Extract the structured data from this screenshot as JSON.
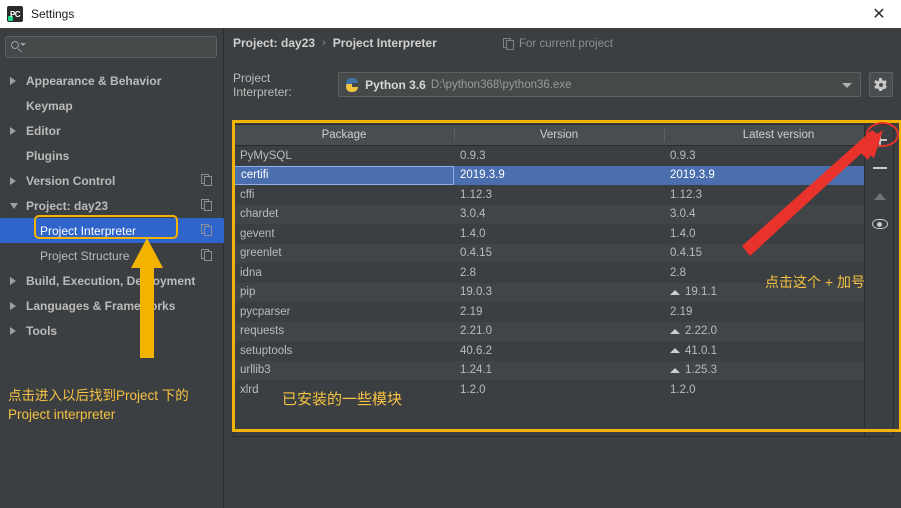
{
  "window": {
    "title": "Settings",
    "app_icon": "pycharm-logo-icon",
    "close_label": "✕"
  },
  "sidebar": {
    "search": {
      "value": "",
      "placeholder": ""
    },
    "items": [
      {
        "label": "Appearance & Behavior",
        "twisty": "right",
        "bold": true,
        "indent": false,
        "scope_icon": false,
        "selected": false
      },
      {
        "label": "Keymap",
        "twisty": "none",
        "bold": true,
        "indent": false,
        "scope_icon": false,
        "selected": false
      },
      {
        "label": "Editor",
        "twisty": "right",
        "bold": true,
        "indent": false,
        "scope_icon": false,
        "selected": false
      },
      {
        "label": "Plugins",
        "twisty": "none",
        "bold": true,
        "indent": false,
        "scope_icon": false,
        "selected": false
      },
      {
        "label": "Version Control",
        "twisty": "right",
        "bold": true,
        "indent": false,
        "scope_icon": true,
        "selected": false
      },
      {
        "label": "Project: day23",
        "twisty": "down",
        "bold": true,
        "indent": false,
        "scope_icon": true,
        "selected": false
      },
      {
        "label": "Project Interpreter",
        "twisty": "none",
        "bold": false,
        "indent": true,
        "scope_icon": true,
        "selected": true
      },
      {
        "label": "Project Structure",
        "twisty": "none",
        "bold": false,
        "indent": true,
        "scope_icon": true,
        "selected": false
      },
      {
        "label": "Build, Execution, Deployment",
        "twisty": "right",
        "bold": true,
        "indent": false,
        "scope_icon": false,
        "selected": false
      },
      {
        "label": "Languages & Frameworks",
        "twisty": "right",
        "bold": true,
        "indent": false,
        "scope_icon": false,
        "selected": false
      },
      {
        "label": "Tools",
        "twisty": "right",
        "bold": true,
        "indent": false,
        "scope_icon": false,
        "selected": false
      }
    ]
  },
  "main": {
    "breadcrumb": {
      "parent": "Project: day23",
      "separator": "›",
      "current": "Project Interpreter"
    },
    "for_current_project": "For current project",
    "interpreter": {
      "label": "Project Interpreter:",
      "name": "Python 3.6",
      "path": "D:\\python368\\python36.exe"
    },
    "table": {
      "columns": [
        "Package",
        "Version",
        "Latest version"
      ],
      "rows": [
        {
          "package": "PyMySQL",
          "version": "0.9.3",
          "latest": "0.9.3",
          "upgradable": false,
          "selected": false
        },
        {
          "package": "certifi",
          "version": "2019.3.9",
          "latest": "2019.3.9",
          "upgradable": false,
          "selected": true
        },
        {
          "package": "cffi",
          "version": "1.12.3",
          "latest": "1.12.3",
          "upgradable": false,
          "selected": false
        },
        {
          "package": "chardet",
          "version": "3.0.4",
          "latest": "3.0.4",
          "upgradable": false,
          "selected": false
        },
        {
          "package": "gevent",
          "version": "1.4.0",
          "latest": "1.4.0",
          "upgradable": false,
          "selected": false
        },
        {
          "package": "greenlet",
          "version": "0.4.15",
          "latest": "0.4.15",
          "upgradable": false,
          "selected": false
        },
        {
          "package": "idna",
          "version": "2.8",
          "latest": "2.8",
          "upgradable": false,
          "selected": false
        },
        {
          "package": "pip",
          "version": "19.0.3",
          "latest": "19.1.1",
          "upgradable": true,
          "selected": false
        },
        {
          "package": "pycparser",
          "version": "2.19",
          "latest": "2.19",
          "upgradable": false,
          "selected": false
        },
        {
          "package": "requests",
          "version": "2.21.0",
          "latest": "2.22.0",
          "upgradable": true,
          "selected": false
        },
        {
          "package": "setuptools",
          "version": "40.6.2",
          "latest": "41.0.1",
          "upgradable": true,
          "selected": false
        },
        {
          "package": "urllib3",
          "version": "1.24.1",
          "latest": "1.25.3",
          "upgradable": true,
          "selected": false
        },
        {
          "package": "xlrd",
          "version": "1.2.0",
          "latest": "1.2.0",
          "upgradable": false,
          "selected": false
        }
      ]
    },
    "toolbar": {
      "add": "add-package-button",
      "remove": "remove-package-button",
      "upgrade": "upgrade-package-button",
      "show_paths": "show-early-releases-button"
    }
  },
  "annotations": {
    "sidebar_note": "点击进入以后找到Project 下的\nProject interpreter",
    "plus_note": "点击这个 + 加号",
    "modules_note": "已安装的一些模块",
    "highlight_color": "#f5b301",
    "arrow_color_red": "#e8322b",
    "text_color": "#f5c242"
  }
}
